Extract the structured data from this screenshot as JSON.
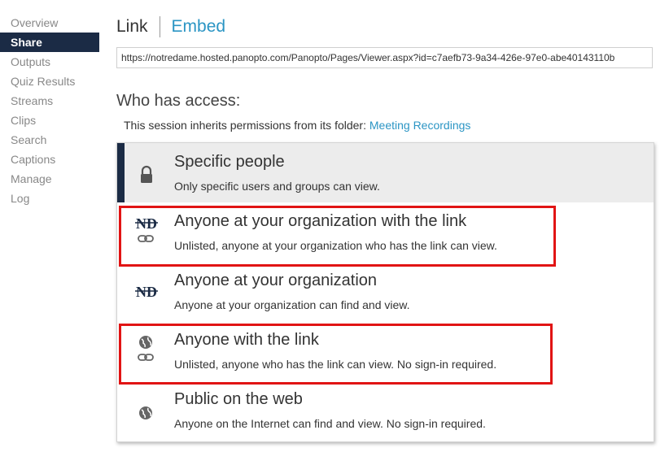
{
  "sidebar": {
    "items": [
      {
        "label": "Overview",
        "active": false
      },
      {
        "label": "Share",
        "active": true
      },
      {
        "label": "Outputs",
        "active": false
      },
      {
        "label": "Quiz Results",
        "active": false
      },
      {
        "label": "Streams",
        "active": false
      },
      {
        "label": "Clips",
        "active": false
      },
      {
        "label": "Search",
        "active": false
      },
      {
        "label": "Captions",
        "active": false
      },
      {
        "label": "Manage",
        "active": false
      },
      {
        "label": "Log",
        "active": false
      }
    ]
  },
  "tabs": {
    "link_label": "Link",
    "embed_label": "Embed"
  },
  "share_url": "https://notredame.hosted.panopto.com/Panopto/Pages/Viewer.aspx?id=c7aefb73-9a34-426e-97e0-abe40143110b",
  "access": {
    "title": "Who has access:",
    "inherit_text": "This session inherits permissions from its folder: ",
    "folder_link": "Meeting Recordings"
  },
  "options": [
    {
      "title": "Specific people",
      "description": "Only specific users and groups can view.",
      "icon": "lock-icon",
      "selected": true,
      "highlighted": false
    },
    {
      "title": "Anyone at your organization with the link",
      "description": "Unlisted, anyone at your organization who has the link can view.",
      "icon": "nd-logo-link-icon",
      "selected": false,
      "highlighted": true
    },
    {
      "title": "Anyone at your organization",
      "description": "Anyone at your organization can find and view.",
      "icon": "nd-logo-icon",
      "selected": false,
      "highlighted": false
    },
    {
      "title": "Anyone with the link",
      "description": "Unlisted, anyone who has the link can view. No sign-in required.",
      "icon": "globe-link-icon",
      "selected": false,
      "highlighted": true
    },
    {
      "title": "Public on the web",
      "description": "Anyone on the Internet can find and view. No sign-in required.",
      "icon": "globe-icon",
      "selected": false,
      "highlighted": false
    }
  ],
  "colors": {
    "nav_active_bg": "#1b2b45",
    "link_blue": "#2b95c4",
    "highlight_red": "#e11414",
    "selected_bg": "#ececec"
  }
}
